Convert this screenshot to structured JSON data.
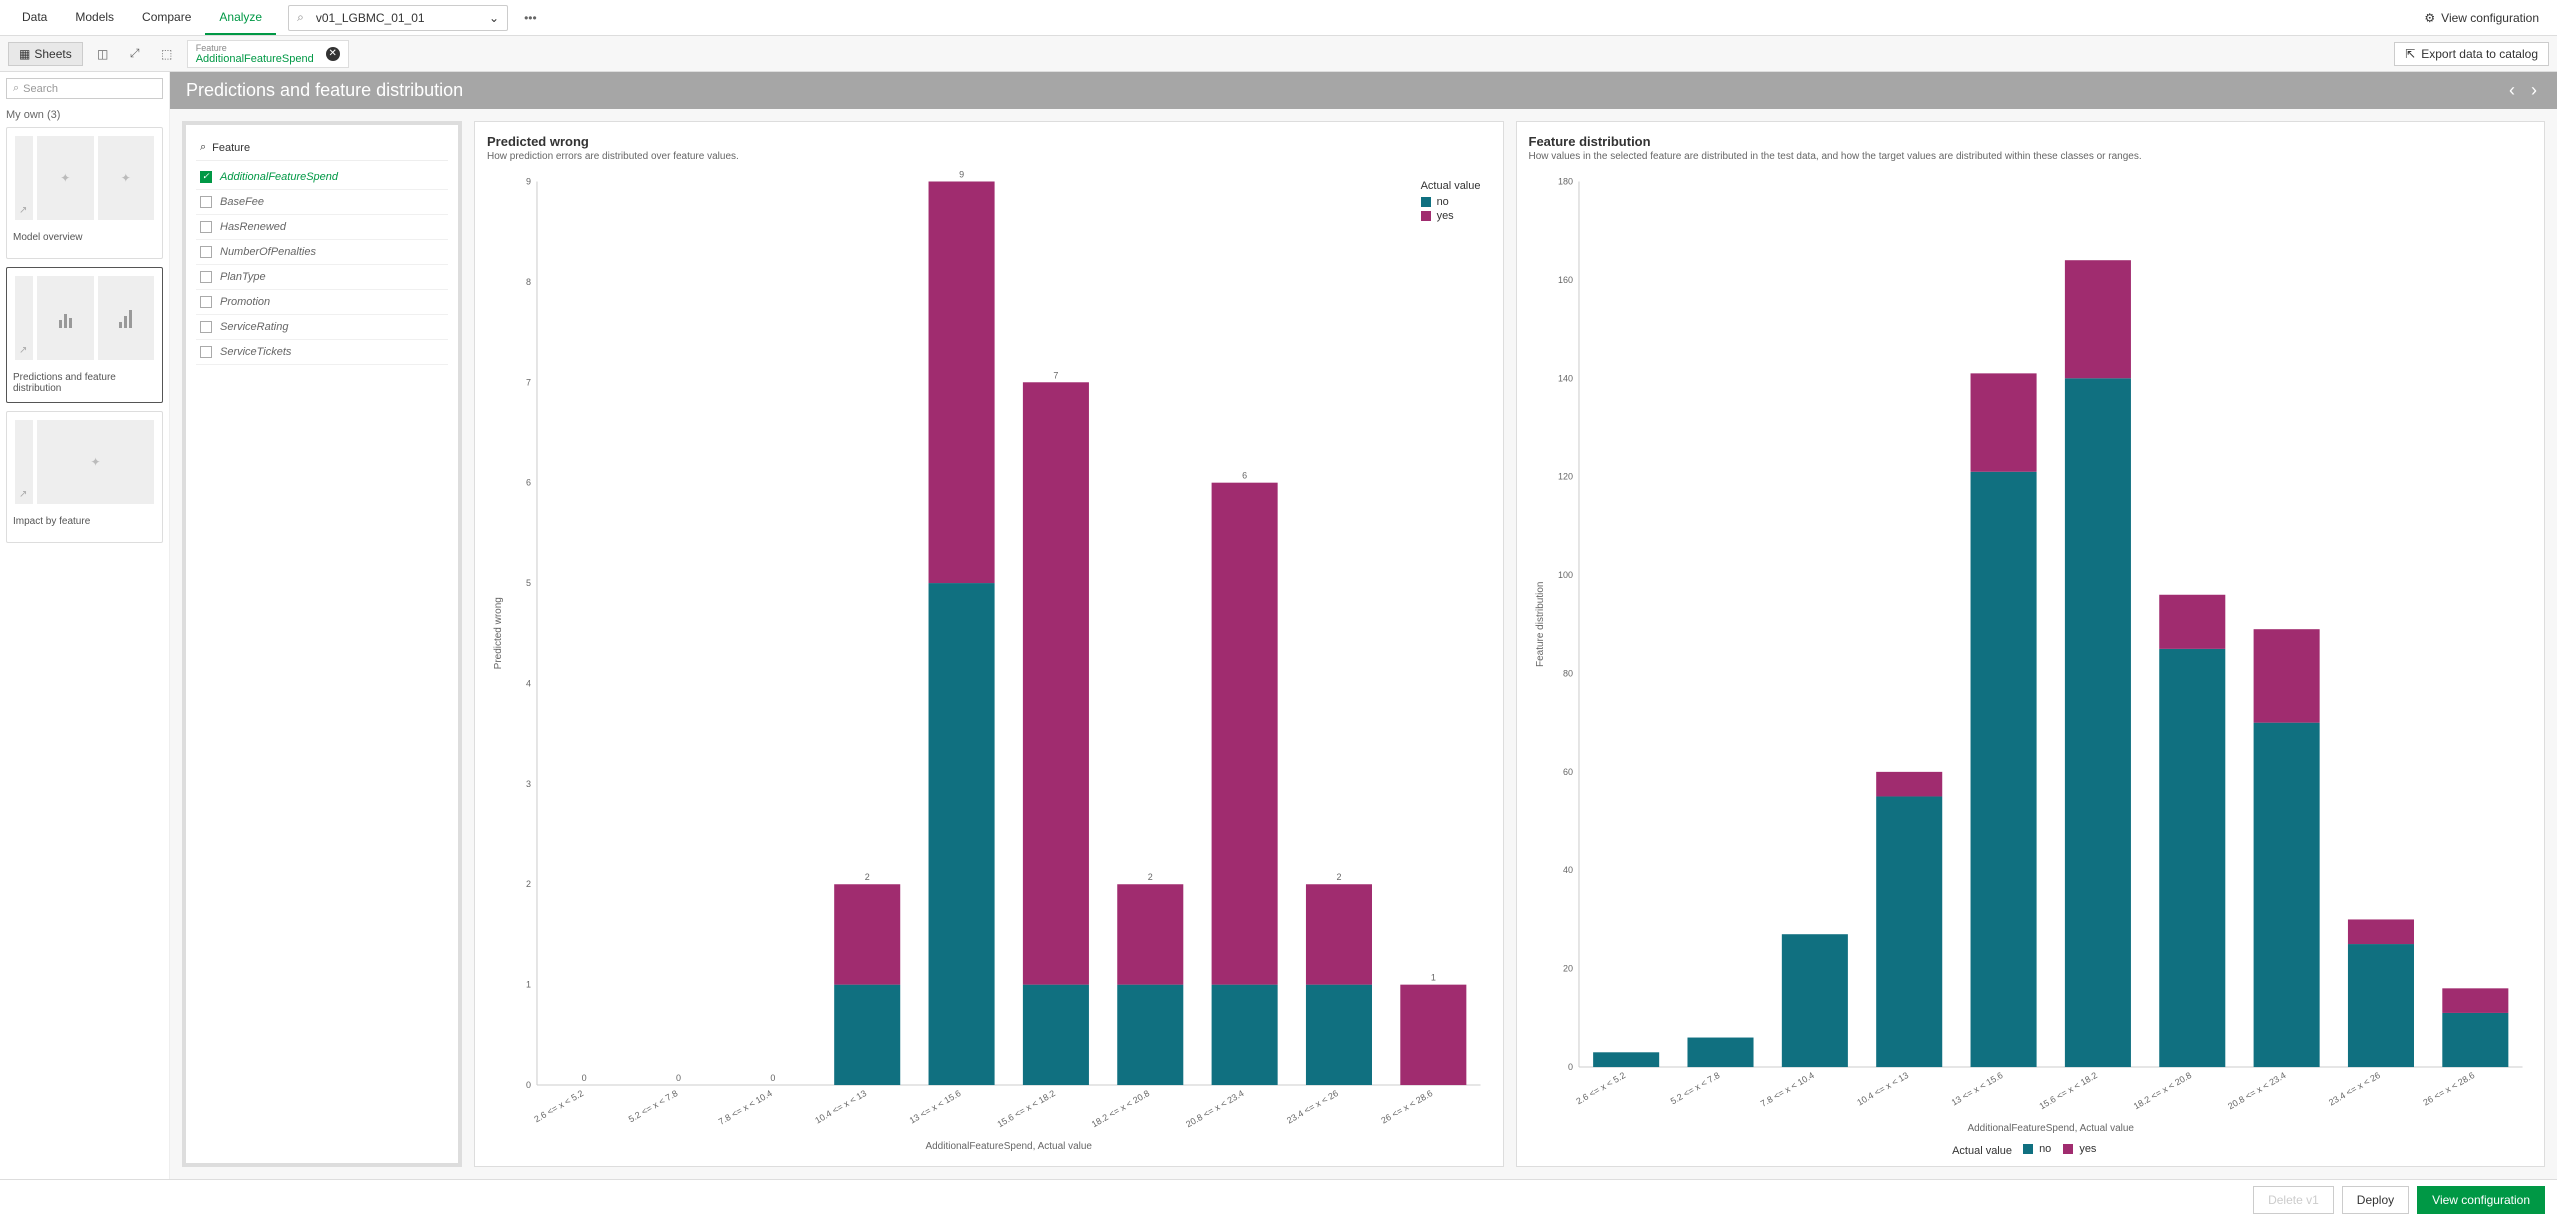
{
  "topbar": {
    "tabs": [
      "Data",
      "Models",
      "Compare",
      "Analyze"
    ],
    "active_tab": "Analyze",
    "model_name": "v01_LGBMC_01_01",
    "view_config": "View configuration"
  },
  "toolbar": {
    "sheets_label": "Sheets",
    "feature_label": "Feature",
    "feature_value": "AdditionalFeatureSpend",
    "export_label": "Export data to catalog"
  },
  "sidebar": {
    "search_placeholder": "Search",
    "section": "My own (3)",
    "thumbs": [
      {
        "label": "Model overview"
      },
      {
        "label": "Predictions and feature distribution"
      },
      {
        "label": "Impact by feature"
      }
    ],
    "active_thumb": 1
  },
  "page_title": "Predictions and feature distribution",
  "feature_panel": {
    "search_label": "Feature",
    "items": [
      {
        "name": "AdditionalFeatureSpend",
        "selected": true
      },
      {
        "name": "BaseFee",
        "selected": false
      },
      {
        "name": "HasRenewed",
        "selected": false
      },
      {
        "name": "NumberOfPenalties",
        "selected": false
      },
      {
        "name": "PlanType",
        "selected": false
      },
      {
        "name": "Promotion",
        "selected": false
      },
      {
        "name": "ServiceRating",
        "selected": false
      },
      {
        "name": "ServiceTickets",
        "selected": false
      }
    ]
  },
  "colors": {
    "no": "#107080",
    "yes": "#a02c6f"
  },
  "chart_data": [
    {
      "type": "bar",
      "title": "Predicted wrong",
      "subtitle": "How prediction errors are distributed over feature values.",
      "xlabel": "AdditionalFeatureSpend, Actual value",
      "ylabel": "Predicted wrong",
      "ylim": [
        0,
        9
      ],
      "legend_title": "Actual value",
      "legend_position": "top-right",
      "categories": [
        "2.6 <= x < 5.2",
        "5.2 <= x < 7.8",
        "7.8 <= x < 10.4",
        "10.4 <= x < 13",
        "13 <= x < 15.6",
        "15.6 <= x < 18.2",
        "18.2 <= x < 20.8",
        "20.8 <= x < 23.4",
        "23.4 <= x < 26",
        "26 <= x < 28.6"
      ],
      "series": [
        {
          "name": "no",
          "values": [
            0,
            0,
            0,
            1,
            5,
            1,
            1,
            1,
            1,
            0
          ]
        },
        {
          "name": "yes",
          "values": [
            0,
            0,
            0,
            1,
            4,
            6,
            1,
            5,
            1,
            1
          ]
        }
      ],
      "totals": [
        0,
        0,
        0,
        2,
        9,
        7,
        2,
        6,
        2,
        1
      ]
    },
    {
      "type": "bar",
      "title": "Feature distribution",
      "subtitle": "How values in the selected feature are distributed in the test data, and how the target values are distributed within these classes or ranges.",
      "xlabel": "AdditionalFeatureSpend, Actual value",
      "ylabel": "Feature distribution",
      "ylim": [
        0,
        180
      ],
      "legend_title": "Actual value",
      "legend_position": "bottom",
      "categories": [
        "2.6 <= x < 5.2",
        "5.2 <= x < 7.8",
        "7.8 <= x < 10.4",
        "10.4 <= x < 13",
        "13 <= x < 15.6",
        "15.6 <= x < 18.2",
        "18.2 <= x < 20.8",
        "20.8 <= x < 23.4",
        "23.4 <= x < 26",
        "26 <= x < 28.6"
      ],
      "series": [
        {
          "name": "no",
          "values": [
            3,
            6,
            27,
            55,
            121,
            140,
            85,
            70,
            25,
            11
          ]
        },
        {
          "name": "yes",
          "values": [
            0,
            0,
            0,
            5,
            20,
            24,
            11,
            19,
            5,
            5
          ]
        }
      ]
    }
  ],
  "footer": {
    "delete": "Delete v1",
    "deploy": "Deploy",
    "view_config": "View configuration"
  }
}
